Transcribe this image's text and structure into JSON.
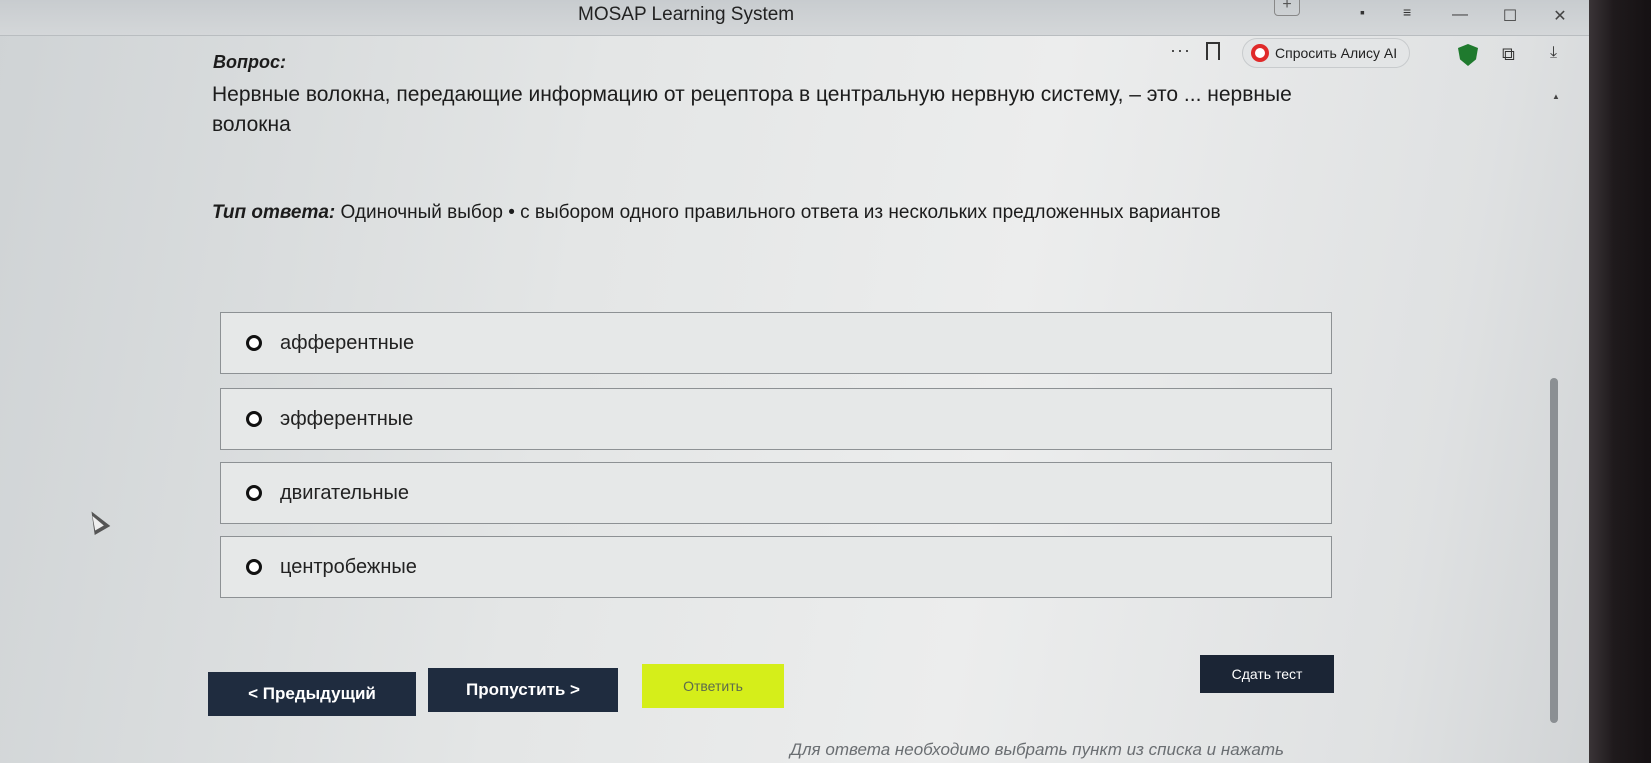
{
  "window": {
    "title": "MOSAP Learning System",
    "tab_plus": "+",
    "minimize": "—",
    "maximize": "☐",
    "close": "✕"
  },
  "toolbar": {
    "more": "···",
    "alice_label": "Спросить Алису AI",
    "extension_glyph": "⧉",
    "download_glyph": "⤓"
  },
  "question": {
    "heading": "Вопрос:",
    "text": "Нервные волокна, передающие информацию от рецептора в центральную нервную систему, – это ... нервные волокна",
    "type_label": "Тип ответа:",
    "type_value": "Одиночный выбор • с выбором одного правильного ответа из нескольких предложенных вариантов"
  },
  "options": [
    {
      "label": "афферентные"
    },
    {
      "label": "эфферентные"
    },
    {
      "label": "двигательные"
    },
    {
      "label": "центробежные"
    }
  ],
  "buttons": {
    "prev": "< Предыдущий",
    "skip": "Пропустить >",
    "answer": "Ответить",
    "submit_test": "Сдать тест"
  },
  "footer": {
    "hint": "Для ответа необходимо выбрать пункт из списка и нажать"
  },
  "colors": {
    "primary_button": "#1f2c3f",
    "answer_button": "#d5ee1a",
    "alice_accent": "#e02a2a",
    "shield": "#1f7a2e"
  },
  "icons": [
    "bookmark-icon",
    "alice-icon",
    "shield-icon",
    "extension-icon",
    "download-icon",
    "cursor-icon"
  ]
}
